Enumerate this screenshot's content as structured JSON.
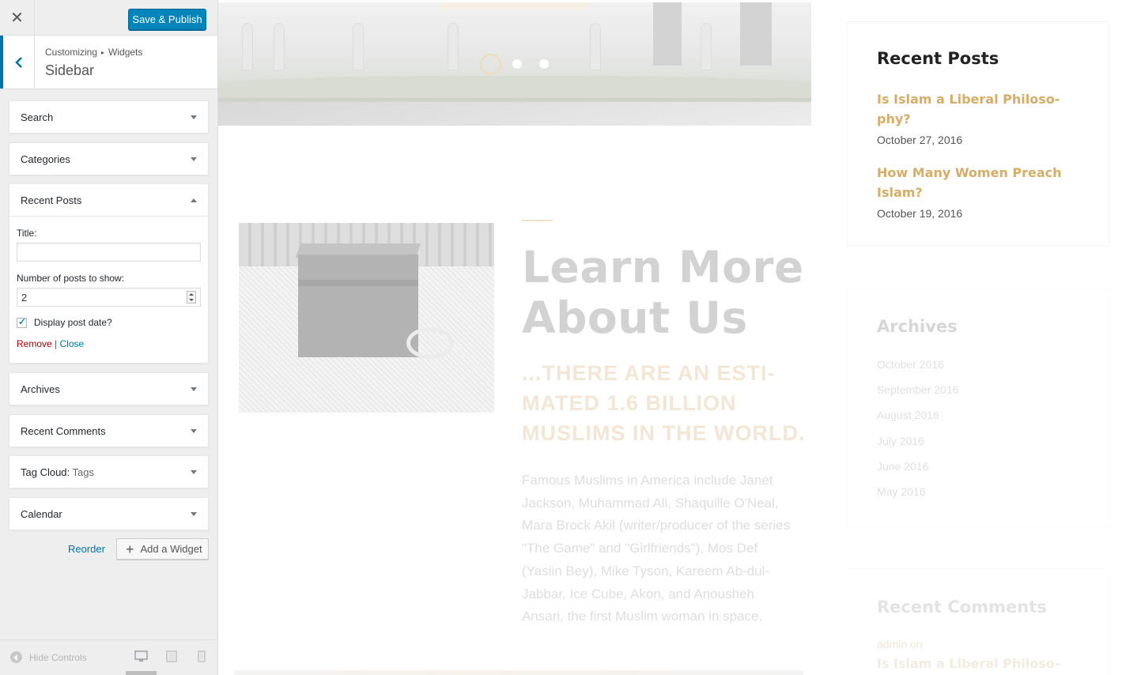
{
  "customizer": {
    "publish_label": "Save & Publish",
    "close_icon": "close-icon",
    "breadcrumb": {
      "root": "Customizing",
      "separator": "▸",
      "parent": "Widgets"
    },
    "section_title": "Sidebar",
    "widgets": [
      {
        "name": "Search"
      },
      {
        "name": "Categories"
      },
      {
        "name": "Recent Posts"
      },
      {
        "name": "Archives"
      },
      {
        "name": "Recent Comments"
      },
      {
        "name": "Tag Cloud:",
        "sub": "Tags"
      },
      {
        "name": "Calendar"
      }
    ],
    "recent_posts_form": {
      "title_label": "Title:",
      "title_value": "",
      "number_label": "Number of posts to show:",
      "number_value": "2",
      "display_date_label": "Display post date?",
      "display_date_checked": true,
      "remove_label": "Remove",
      "separator": "|",
      "close_label": "Close"
    },
    "reorder_label": "Reorder",
    "add_widget_label": "Add a Widget",
    "hide_controls_label": "Hide Controls",
    "devices": [
      "desktop-icon",
      "tablet-icon",
      "mobile-icon"
    ],
    "accent_color": "#0073aa",
    "publish_color": "#0085ba"
  },
  "preview": {
    "about": {
      "heading": "Learn More About Us",
      "subheading": "...THERE ARE AN ESTI-MATED 1.6 BILLION MUSLIMS IN THE WORLD.",
      "body": "Famous Muslims in America include Janet Jackson, Muhammad Ali, Shaquille O'Neal, Mara Brock Akil (writer/producer of the series \"The Game\" and \"Girlfriends\"), Mos Def (Yasiin Bey), Mike Tyson, Kareem Ab-dul-Jabbar, Ice Cube, Akon, and Anousheh Ansari, the first Muslim woman in space."
    },
    "recent_posts": {
      "title": "Recent Posts",
      "posts": [
        {
          "title": "Is Islam a Liberal Philoso-phy?",
          "date": "October 27, 2016"
        },
        {
          "title": "How Many Women Preach Islam?",
          "date": "October 19, 2016"
        }
      ]
    },
    "archives": {
      "title": "Archives",
      "items": [
        "October 2016",
        "September 2016",
        "August 2016",
        "July 2016",
        "June 2016",
        "May 2016"
      ]
    },
    "recent_comments": {
      "title": "Recent Comments",
      "line1": "admin on",
      "line2": "Is Islam a Liberal Philoso-"
    },
    "link_color": "#d7ac66"
  }
}
